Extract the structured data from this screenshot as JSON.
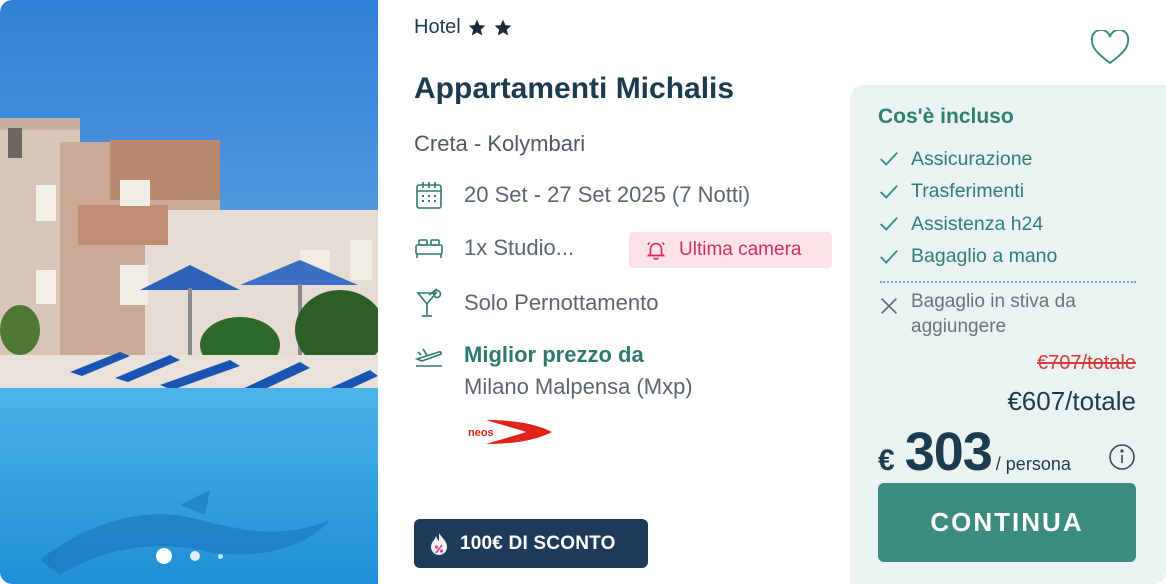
{
  "hotel": {
    "category_label": "Hotel",
    "stars": 2,
    "name": "Appartamenti Michalis",
    "location": "Creta - Kolymbari",
    "dates": "20 Set - 27 Set 2025 (7 Notti)",
    "room": "1x Studio...",
    "last_room_badge": "Ultima camera",
    "board": "Solo Pernottamento",
    "flight_title": "Miglior prezzo da",
    "flight_origin": "Milano Malpensa (Mxp)",
    "airline_logo_text": "neos",
    "discount_badge": "100€ DI SCONTO"
  },
  "gallery": {
    "total_images": 3,
    "active_index": 0
  },
  "icons": {
    "calendar": "calendar-icon",
    "bed": "bed-icon",
    "cocktail": "cocktail-icon",
    "plane": "plane-icon",
    "bell": "bell-icon",
    "heart": "heart-icon",
    "check": "check-icon",
    "cross": "cross-icon",
    "info": "info-icon",
    "discount": "discount-tag-icon"
  },
  "included": {
    "title": "Cos'è incluso",
    "items": [
      "Assicurazione",
      "Trasferimenti",
      "Assistenza h24",
      "Bagaglio a mano"
    ],
    "excluded": "Bagaglio in stiva da aggiungere"
  },
  "pricing": {
    "old_total": "€707/totale",
    "total": "€607/totale",
    "currency": "€",
    "per_person_amount": "303",
    "per_person_label": "/ persona"
  },
  "cta": {
    "label": "CONTINUA"
  },
  "colors": {
    "primary": "#3b8c7e",
    "heading": "#1d3b4f",
    "panel_bg": "#eaf3f2",
    "alert": "#d0315a",
    "badge_bg": "#1d3b5a"
  }
}
